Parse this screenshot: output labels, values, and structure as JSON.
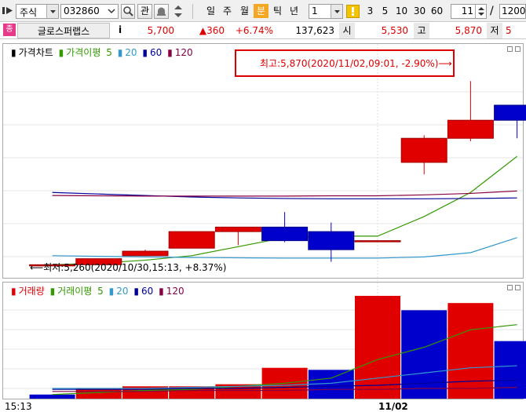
{
  "toolbar": {
    "market": "주식",
    "code": "032860",
    "gwan": "관",
    "periods": [
      "일",
      "주",
      "월",
      "분",
      "틱",
      "년"
    ],
    "active_period": "분",
    "interval_value": "1",
    "minute_buttons": [
      "3",
      "5",
      "10",
      "30",
      "60"
    ],
    "count_value": "11",
    "separator": "/",
    "total_value": "1200"
  },
  "quote": {
    "stock_name": "글로스퍼랩스",
    "info_label": "i",
    "price": "5,700",
    "change": "▲360",
    "change_pct": "+6.74%",
    "volume": "137,623",
    "open_label": "시",
    "open": "5,530",
    "high_label": "고",
    "high": "5,870",
    "low_label": "저",
    "low": "5"
  },
  "price_panel": {
    "legend_title": "가격차트",
    "ma_title": "가격이평",
    "ma_periods": [
      "5",
      "20",
      "60",
      "120"
    ],
    "high_annotation": "최고:5,870(2020/11/02,09:01, -2.90%)⟶",
    "low_annotation": "⟵최저:5,260(2020/10/30,15:13, +8.37%)"
  },
  "volume_panel": {
    "legend_title": "거래량",
    "ma_title": "거래이평",
    "ma_periods": [
      "5",
      "20",
      "60",
      "120"
    ]
  },
  "x_axis": {
    "labels": [
      "15:13",
      "11/02"
    ]
  },
  "colors": {
    "up": "#e00000",
    "down": "#0000cc",
    "ma5": "#339900",
    "ma20": "#3399cc",
    "ma60": "#000099",
    "ma120": "#880044",
    "highlight_box": "#dd0000"
  },
  "chart_data": [
    {
      "type": "candlestick",
      "title": "가격차트",
      "x": [
        "10/30 15:13",
        "",
        "",
        "",
        "",
        "",
        "",
        "",
        "11/02 09:01",
        "",
        ""
      ],
      "candles": [
        {
          "open": 5260,
          "high": 5260,
          "low": 5260,
          "close": 5260
        },
        {
          "open": 5260,
          "high": 5280,
          "low": 5260,
          "close": 5280
        },
        {
          "open": 5290,
          "high": 5310,
          "low": 5290,
          "close": 5305
        },
        {
          "open": 5315,
          "high": 5370,
          "low": 5315,
          "close": 5370
        },
        {
          "open": 5370,
          "high": 5380,
          "low": 5325,
          "close": 5385
        },
        {
          "open": 5385,
          "high": 5435,
          "low": 5335,
          "close": 5340
        },
        {
          "open": 5370,
          "high": 5400,
          "low": 5270,
          "close": 5310
        },
        {
          "open": 5340,
          "high": 5340,
          "low": 5340,
          "close": 5340
        },
        {
          "open": 5600,
          "high": 5690,
          "low": 5560,
          "close": 5680
        },
        {
          "open": 5680,
          "high": 5870,
          "low": 5670,
          "close": 5740
        },
        {
          "open": 5790,
          "high": 5790,
          "low": 5680,
          "close": 5740
        }
      ],
      "ma_series": [
        {
          "name": "5",
          "values": [
            5260,
            5265,
            5275,
            5290,
            5320,
            5350,
            5355,
            5355,
            5420,
            5500,
            5620
          ]
        },
        {
          "name": "20",
          "values": [
            5290,
            5288,
            5286,
            5284,
            5283,
            5282,
            5282,
            5282,
            5286,
            5300,
            5350
          ]
        },
        {
          "name": "60",
          "values": [
            5500,
            5495,
            5490,
            5485,
            5482,
            5480,
            5479,
            5479,
            5479,
            5480,
            5482
          ]
        },
        {
          "name": "120",
          "values": [
            5490,
            5489,
            5488,
            5488,
            5488,
            5488,
            5489,
            5489,
            5492,
            5497,
            5505
          ]
        }
      ]
    },
    {
      "type": "bar",
      "title": "거래량",
      "x": [
        "10/30 15:13",
        "",
        "",
        "",
        "",
        "",
        "",
        "",
        "11/02 09:01",
        "",
        ""
      ],
      "values": [
        4,
        10,
        12,
        12,
        14,
        30,
        28,
        100,
        86,
        93,
        56
      ],
      "colors": [
        "down",
        "up",
        "up",
        "up",
        "up",
        "up",
        "down",
        "up",
        "down",
        "up",
        "down"
      ],
      "ma_series": [
        {
          "name": "5",
          "values": [
            4,
            6,
            8,
            9,
            12,
            15,
            20,
            38,
            50,
            67,
            72
          ]
        },
        {
          "name": "20",
          "values": [
            10,
            10,
            10,
            11,
            12,
            13,
            15,
            20,
            25,
            30,
            32
          ]
        },
        {
          "name": "60",
          "values": [
            9,
            9,
            9,
            10,
            10,
            11,
            12,
            13,
            15,
            17,
            18
          ]
        },
        {
          "name": "120",
          "values": [
            7,
            7,
            7,
            8,
            8,
            8,
            9,
            9,
            10,
            10,
            11
          ]
        }
      ]
    }
  ]
}
